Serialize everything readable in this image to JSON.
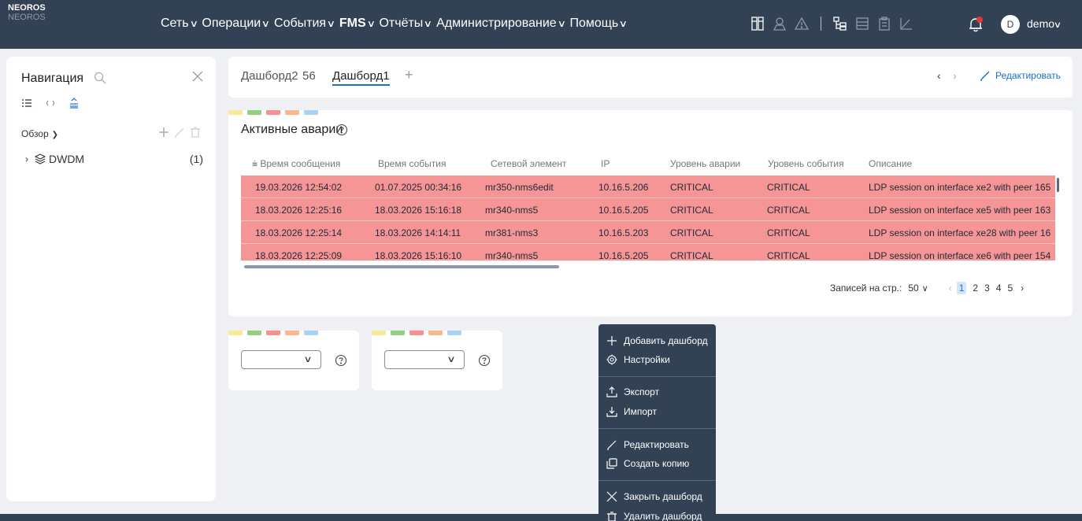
{
  "app": {
    "logo_line1": "NEOROS",
    "logo_line2": "NEOROS"
  },
  "topnav": {
    "items": [
      {
        "label": "Сеть"
      },
      {
        "label": "Операции"
      },
      {
        "label": "События"
      },
      {
        "label": "FMS"
      },
      {
        "label": "Отчёты"
      },
      {
        "label": "Администрирование"
      },
      {
        "label": "Помощь"
      }
    ],
    "user_initial": "D",
    "user_name": "demo"
  },
  "nav": {
    "title": "Навигация",
    "view": "Обзор",
    "tree": [
      {
        "label": "DWDM",
        "count": "(1)"
      }
    ]
  },
  "dashboards": {
    "tabs": [
      {
        "label": "Дашборд2"
      },
      {
        "label": "56"
      },
      {
        "label": "Дашборд1"
      }
    ],
    "active_tab": "Дашборд1",
    "add": "+",
    "edit_label": "Редактировать"
  },
  "flag_colors": [
    "#f8ea96",
    "#93cf83",
    "#f59191",
    "#f7b98d",
    "#a9d2f3"
  ],
  "alarms": {
    "title": "Активные аварии",
    "columns": [
      "Время сообщения",
      "Время события",
      "Сетевой элемент",
      "IP",
      "Уровень аварии",
      "Уровень события",
      "Описание"
    ],
    "rows": [
      [
        "19.03.2026 12:54:02",
        "01.07.2025 00:34:16",
        "mr350-nms6edit",
        "10.16.5.206",
        "CRITICAL",
        "CRITICAL",
        "LDP session on interface xe2 with peer 165"
      ],
      [
        "18.03.2026 12:25:16",
        "18.03.2026 15:16:18",
        "mr340-nms5",
        "10.16.5.205",
        "CRITICAL",
        "CRITICAL",
        "LDP session on interface xe5 with peer 163"
      ],
      [
        "18.03.2026 12:25:14",
        "18.03.2026 14:14:11",
        "mr381-nms3",
        "10.16.5.203",
        "CRITICAL",
        "CRITICAL",
        "LDP session on interface xe28 with peer 16"
      ],
      [
        "18.03.2026 12:25:09",
        "18.03.2026 15:16:10",
        "mr340-nms5",
        "10.16.5.205",
        "CRITICAL",
        "CRITICAL",
        "LDP session on interface xe6 with peer 154"
      ]
    ],
    "row_color": "#f59595",
    "pager": {
      "per_page_label": "Записей на стр.:",
      "per_page_value": "50",
      "pages": [
        "1",
        "2",
        "3",
        "4",
        "5"
      ],
      "current": "1"
    }
  },
  "context_menu": {
    "items": [
      {
        "label": "Добавить дашборд",
        "icon": "plus-icon"
      },
      {
        "label": "Настройки",
        "icon": "gear-icon"
      },
      {
        "label": "Экспорт",
        "icon": "export-icon"
      },
      {
        "label": "Импорт",
        "icon": "import-icon"
      },
      {
        "label": "Редактировать",
        "icon": "pencil-icon"
      },
      {
        "label": "Создать копию",
        "icon": "copy-icon"
      },
      {
        "label": "Закрыть дашборд",
        "icon": "close-icon"
      },
      {
        "label": "Удалить дашборд",
        "icon": "trash-icon"
      }
    ]
  },
  "colors": {
    "topbar": "#334155",
    "accent": "#1a73c9",
    "critical_row": "#f59595"
  }
}
